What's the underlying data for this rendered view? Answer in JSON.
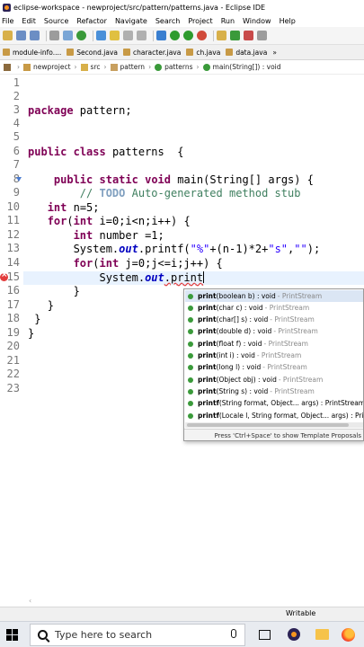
{
  "window": {
    "title": "eclipse-workspace - newproject/src/pattern/patterns.java - Eclipse IDE"
  },
  "menu": [
    "File",
    "Edit",
    "Source",
    "Refactor",
    "Navigate",
    "Search",
    "Project",
    "Run",
    "Window",
    "Help"
  ],
  "tabs": [
    "module-info....",
    "Second.java",
    "character.java",
    "ch.java",
    "data.java"
  ],
  "tabs_overflow": "»",
  "breadcrumb": [
    "module",
    "newproject",
    "src",
    "pattern",
    "patterns",
    "main(String[]) : void"
  ],
  "line_numbers": [
    "1",
    "2",
    "3",
    "4",
    "5",
    "6",
    "7",
    "8",
    "9",
    "10",
    "11",
    "12",
    "13",
    "14",
    "15",
    "16",
    "17",
    "18",
    "19",
    "20",
    "21",
    "22",
    "23"
  ],
  "code": {
    "l3_kw": "package",
    "l3_rest": " pattern;",
    "l6_kw1": "public",
    "l6_kw2": "class",
    "l6_rest": " patterns  {",
    "l8_kw1": "public",
    "l8_kw2": "static",
    "l8_kw3": "void",
    "l8_rest": " main(String[] args) {",
    "l9_pre": "// ",
    "l9_todo": "TODO",
    "l9_rest": " Auto-generated method stub",
    "l10_kw": "int",
    "l10_rest": " n=5;",
    "l11_kw1": "for",
    "l11_mid1": "(",
    "l11_kw2": "int",
    "l11_rest": " i=0;i<n;i++) {",
    "l12_kw": "int",
    "l12_rest": " number =1;",
    "l13_pre": "System.",
    "l13_fld": "out",
    "l13_mid": ".printf(",
    "l13_str1": "\"%\"",
    "l13_mid2": "+(n-1)*2+",
    "l13_str2": "\"s\"",
    "l13_mid3": ",",
    "l13_str3": "\"\"",
    "l13_end": ");",
    "l14_kw1": "for",
    "l14_mid1": "(",
    "l14_kw2": "int",
    "l14_rest": " j=0;j<=i;j++) {",
    "l15_pre": "System.",
    "l15_fld": "out",
    "l15_err": ".print",
    "l16": "}",
    "l17": "}",
    "l18": "}",
    "l19": "}"
  },
  "content_assist": {
    "items": [
      {
        "name": "print",
        "params": "(boolean b) : void",
        "owner": " - PrintStream"
      },
      {
        "name": "print",
        "params": "(char c) : void",
        "owner": " - PrintStream"
      },
      {
        "name": "print",
        "params": "(char[] s) : void",
        "owner": " - PrintStream"
      },
      {
        "name": "print",
        "params": "(double d) : void",
        "owner": " - PrintStream"
      },
      {
        "name": "print",
        "params": "(float f) : void",
        "owner": " - PrintStream"
      },
      {
        "name": "print",
        "params": "(int i) : void",
        "owner": " - PrintStream"
      },
      {
        "name": "print",
        "params": "(long l) : void",
        "owner": " - PrintStream"
      },
      {
        "name": "print",
        "params": "(Object obj) : void",
        "owner": " - PrintStream"
      },
      {
        "name": "print",
        "params": "(String s) : void",
        "owner": " - PrintStream"
      },
      {
        "name": "printf",
        "params": "(String format, Object... args) : PrintStream",
        "owner": ""
      },
      {
        "name": "printf",
        "params": "(Locale l, String format, Object... args) : PrintStream",
        "owner": ""
      }
    ],
    "footer": "Press 'Ctrl+Space' to show Template Proposals"
  },
  "status": {
    "writable": "Writable"
  },
  "taskbar": {
    "search_placeholder": "Type here to search"
  },
  "colors": {
    "keyword": "#7f0055",
    "comment": "#3f7f5f",
    "string": "#2a00ff",
    "field": "#0000c0",
    "line_number": "#787878",
    "error": "#e23c3c"
  }
}
